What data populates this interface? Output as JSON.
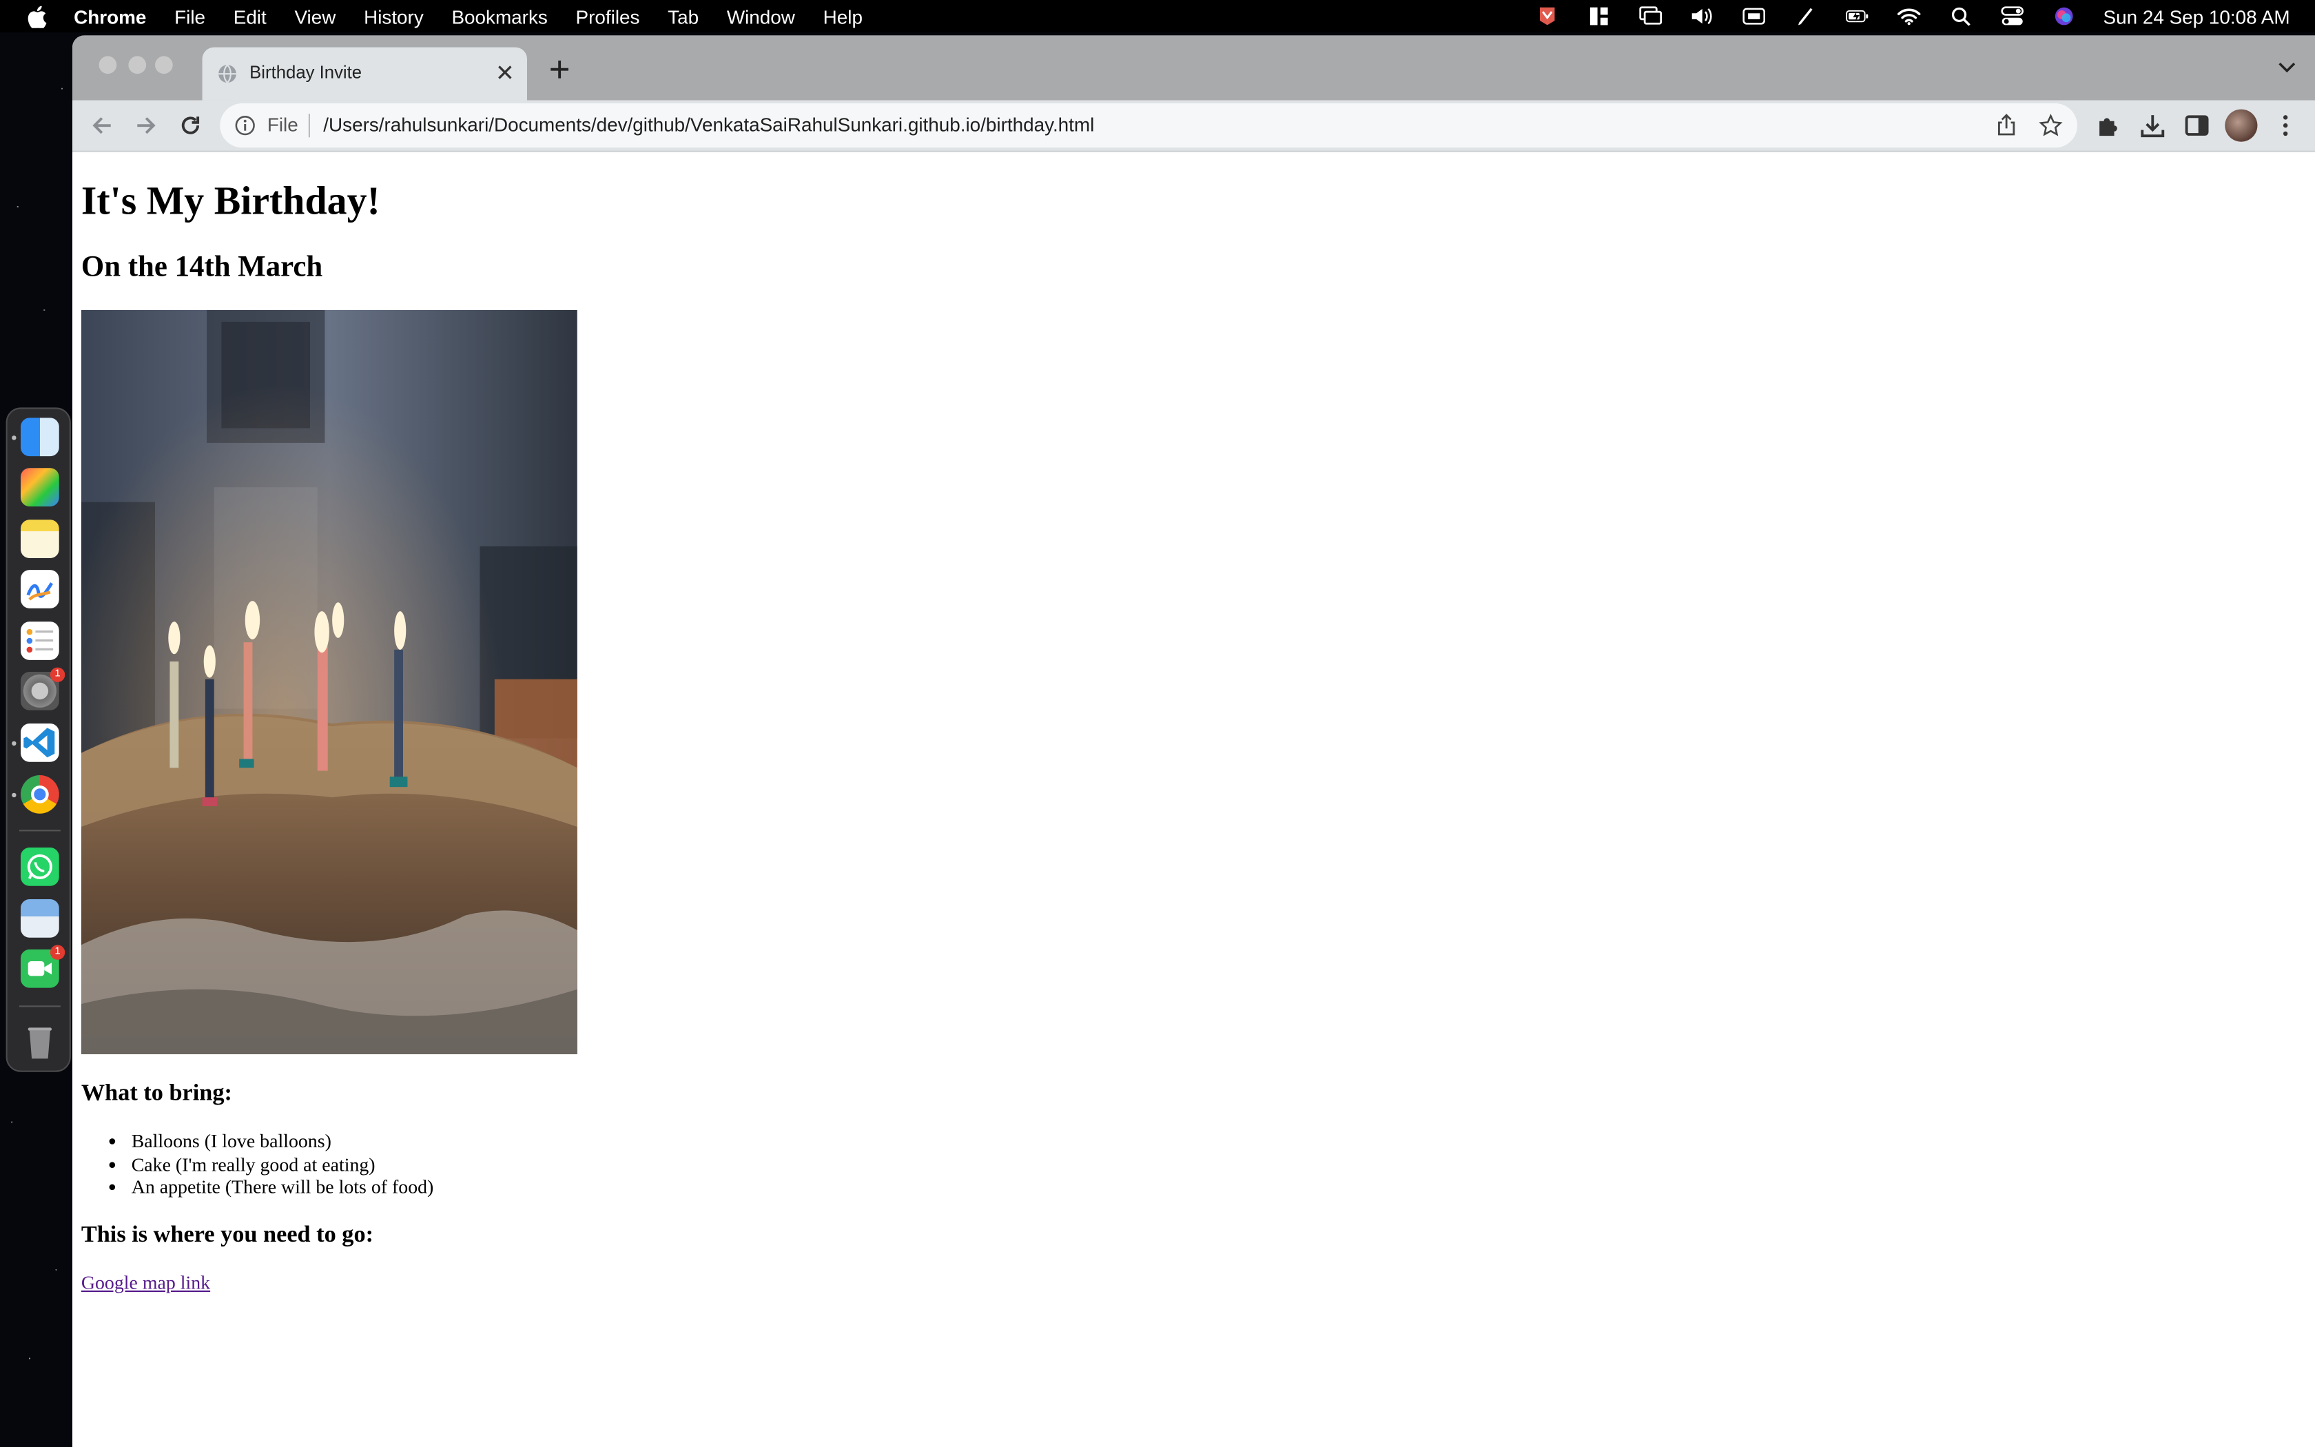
{
  "menubar": {
    "app_name": "Chrome",
    "items": [
      "File",
      "Edit",
      "View",
      "History",
      "Bookmarks",
      "Profiles",
      "Tab",
      "Window",
      "Help"
    ],
    "clock": "Sun 24 Sep  10:08 AM"
  },
  "dock": {
    "apps": [
      "finder",
      "launchpad",
      "notes",
      "freeform",
      "reminders",
      "system-settings",
      "vscode",
      "chrome",
      "whatsapp",
      "preview",
      "facetime",
      "trash"
    ],
    "badges": {
      "system_settings": "1",
      "facetime": "1"
    }
  },
  "browser": {
    "tab_title": "Birthday Invite",
    "omnibox": {
      "scheme_label": "File",
      "url": "/Users/rahulsunkari/Documents/dev/github/VenkataSaiRahulSunkari.github.io/birthday.html"
    }
  },
  "page": {
    "heading": "It's My Birthday!",
    "date_heading": "On the 14th March",
    "bring_heading": "What to bring:",
    "bring_items": [
      "Balloons (I love balloons)",
      "Cake (I'm really good at eating)",
      "An appetite (There will be lots of food)"
    ],
    "where_heading": "This is where you need to go:",
    "map_link_text": "Google map link"
  },
  "colors": {
    "menubar_bg": "#000000",
    "tabstrip_bg": "#a9aaab",
    "toolbar_bg": "#dfe3e6",
    "visited_link": "#551a8b"
  }
}
